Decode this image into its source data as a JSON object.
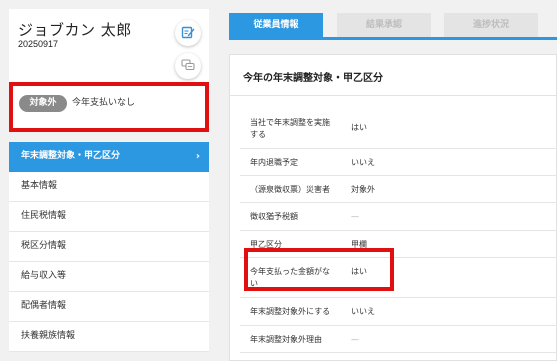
{
  "employee": {
    "name": "ジョブカン 太郎",
    "code": "20250917",
    "status_badge": "対象外",
    "status_text": "今年支払いなし"
  },
  "icons": {
    "edit": "edit-note-icon",
    "chat": "chat-bubble-icon",
    "chevron": "chevron-right-icon"
  },
  "colors": {
    "accent": "#2c98e2",
    "highlight": "#e01010",
    "badge": "#8a8a8a"
  },
  "sidebar": {
    "items": [
      {
        "label": "年末調整対象・甲乙区分",
        "active": true,
        "chevron": "›"
      },
      {
        "label": "基本情報"
      },
      {
        "label": "住民税情報"
      },
      {
        "label": "税区分情報"
      },
      {
        "label": "給与収入等"
      },
      {
        "label": "配偶者情報"
      },
      {
        "label": "扶養親族情報"
      }
    ]
  },
  "tabs": [
    {
      "label": "従業員情報",
      "active": true
    },
    {
      "label": "結果承認",
      "active": false
    },
    {
      "label": "進捗状況",
      "active": false
    }
  ],
  "panel": {
    "title": "今年の年末調整対象・甲乙区分",
    "rows": [
      {
        "key_line1": "当社で年末調整を実施",
        "key_line2": "する",
        "value": "はい"
      },
      {
        "key_line1": "年内退職予定",
        "value": "いいえ"
      },
      {
        "key_line1": "（源泉徴収票）災害者",
        "value": "対象外"
      },
      {
        "key_line1": "徴収猶予税額",
        "value": "—"
      },
      {
        "key_line1": "甲乙区分",
        "value": "甲欄"
      },
      {
        "key_line1": "今年支払った金額がな",
        "key_line2": "い",
        "value": "はい"
      },
      {
        "key_line1": "年末調整対象外にする",
        "value": "いいえ"
      },
      {
        "key_line1": "年末調整対象外理由",
        "value": "—"
      }
    ]
  }
}
